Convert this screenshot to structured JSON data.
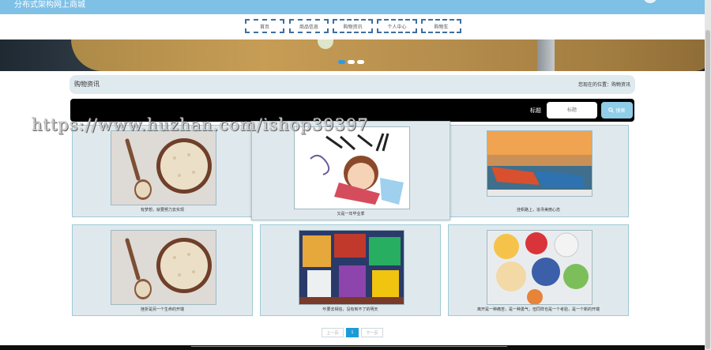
{
  "header": {
    "site_title": "分布式架构网上商城"
  },
  "nav": {
    "items": [
      "首页",
      "商品信息",
      "购物资讯",
      "个人中心",
      "购物车"
    ]
  },
  "banner": {
    "slide_count": 3,
    "active_slide": 1
  },
  "section": {
    "title": "购物资讯",
    "breadcrumb": "您现在的位置：购物资讯"
  },
  "search": {
    "label": "标题",
    "placeholder": "标题",
    "button_label": "搜索"
  },
  "news": [
    {
      "caption": "有梦想，就要努力去实现",
      "image": "oats-bowl-with-spoon"
    },
    {
      "caption": "又是一年毕业季",
      "image": "cartoon-student-reading"
    },
    {
      "caption": "挂帆路上，追寻美丽心态",
      "image": "kayaks-by-water"
    },
    {
      "caption": "挫折是另一个生命的开端",
      "image": "oats-bowl-with-spoon"
    },
    {
      "caption": "吵要去相信，没有到不了的明天",
      "image": "colorful-shop-shelves"
    },
    {
      "caption": "离开是一种痛苦，是一种勇气，但同样也是一个考验，是一个新的开端",
      "image": "breakfast-bowls"
    }
  ],
  "pagination": {
    "prev": "上一页",
    "current": "1",
    "next": "下一页"
  },
  "watermark": "https://www.huzhan.com/ishop39397",
  "colors": {
    "header_bg": "#7ec0e6",
    "card_bg": "#dfe9ed",
    "accent": "#1d9bd7"
  }
}
